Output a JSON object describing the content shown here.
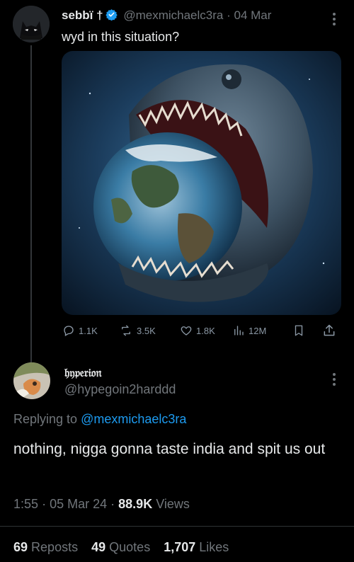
{
  "tweet": {
    "display_name": "sebbï †",
    "handle": "@mexmichaelc3ra",
    "separator": "·",
    "date": "04 Mar",
    "text": "wyd in this situation?",
    "actions": {
      "replies": "1.1K",
      "reposts": "3.5K",
      "likes": "1.8K",
      "views": "12M"
    }
  },
  "reply": {
    "display_name": "𝔥𝔶𝔭𝔢𝔯𝔦𝔬𝔫",
    "handle": "@hypegoin2harddd",
    "replying_prefix": "Replying to",
    "replying_handle": "@mexmichaelc3ra",
    "text": "nothing, nigga gonna taste india and spit us out",
    "time": "1:55",
    "date": "05 Mar 24",
    "separator": "·",
    "views_count": "88.9K",
    "views_label": "Views",
    "reposts_count": "69",
    "reposts_label": "Reposts",
    "quotes_count": "49",
    "quotes_label": "Quotes",
    "likes_count": "1,707",
    "likes_label": "Likes"
  },
  "colors": {
    "accent": "#1d9bf0",
    "muted": "#71767b",
    "text": "#e7e9ea",
    "background": "#000000"
  }
}
